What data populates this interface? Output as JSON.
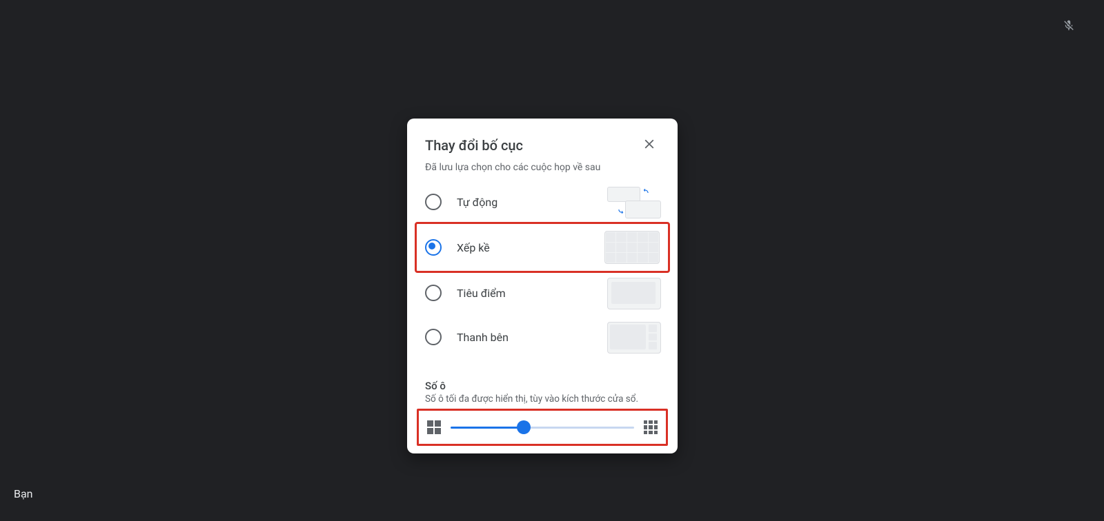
{
  "self_name": "Bạn",
  "dialog": {
    "title": "Thay đổi bố cục",
    "subtitle": "Đã lưu lựa chọn cho các cuộc họp về sau",
    "options": [
      {
        "label": "Tự động",
        "selected": false,
        "highlighted": false,
        "preview": "auto"
      },
      {
        "label": "Xếp kề",
        "selected": true,
        "highlighted": true,
        "preview": "tiles"
      },
      {
        "label": "Tiêu điểm",
        "selected": false,
        "highlighted": false,
        "preview": "spotlight"
      },
      {
        "label": "Thanh bên",
        "selected": false,
        "highlighted": false,
        "preview": "sidebar"
      }
    ],
    "tiles_section": {
      "title": "Số ô",
      "subtitle": "Số ô tối đa được hiển thị, tùy vào kích thước cửa sổ.",
      "slider_percent": 40
    }
  },
  "icons": {
    "close": "close-icon",
    "mic_off": "mic-off-icon",
    "grid_small": "grid-2x2-icon",
    "grid_large": "grid-3x3-icon"
  }
}
